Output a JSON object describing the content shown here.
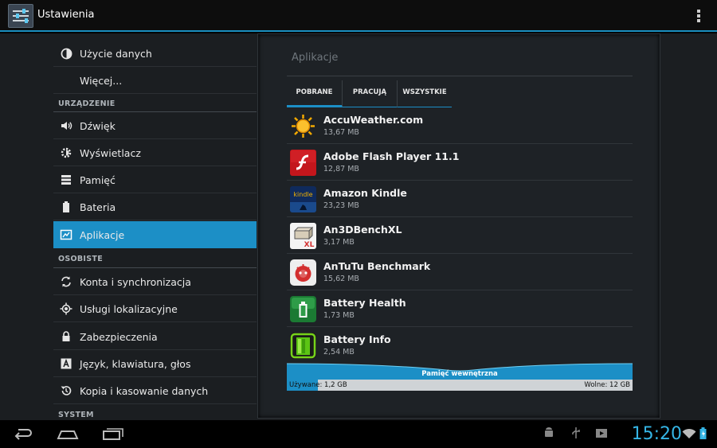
{
  "action_bar": {
    "title": "Ustawienia"
  },
  "sidebar": {
    "items": [
      {
        "label": "Użycie danych",
        "icon": "data-usage-icon"
      },
      {
        "label": "Więcej...",
        "icon": ""
      }
    ],
    "sections": [
      {
        "header": "URZĄDZENIE",
        "items": [
          {
            "label": "Dźwięk",
            "icon": "sound-icon"
          },
          {
            "label": "Wyświetlacz",
            "icon": "display-icon"
          },
          {
            "label": "Pamięć",
            "icon": "storage-icon"
          },
          {
            "label": "Bateria",
            "icon": "battery-icon"
          },
          {
            "label": "Aplikacje",
            "icon": "apps-icon",
            "active": true
          }
        ]
      },
      {
        "header": "OSOBISTE",
        "items": [
          {
            "label": "Konta i synchronizacja",
            "icon": "sync-icon"
          },
          {
            "label": "Usługi lokalizacyjne",
            "icon": "location-icon"
          },
          {
            "label": "Zabezpieczenia",
            "icon": "lock-icon"
          },
          {
            "label": "Język, klawiatura, głos",
            "icon": "language-icon"
          },
          {
            "label": "Kopia i kasowanie danych",
            "icon": "backup-icon"
          }
        ]
      },
      {
        "header": "SYSTEM",
        "items": []
      }
    ]
  },
  "panel": {
    "title": "Aplikacje",
    "tabs": [
      {
        "label": "POBRANE",
        "selected": true
      },
      {
        "label": "PRACUJĄ",
        "selected": false
      },
      {
        "label": "WSZYSTKIE",
        "selected": false
      }
    ],
    "apps": [
      {
        "name": "AccuWeather.com",
        "size": "13,67 MB",
        "icon": "accuweather-sun-icon"
      },
      {
        "name": "Adobe Flash Player 11.1",
        "size": "12,87 MB",
        "icon": "flash-player-icon"
      },
      {
        "name": "Amazon Kindle",
        "size": "23,23 MB",
        "icon": "kindle-icon"
      },
      {
        "name": "An3DBenchXL",
        "size": "3,17 MB",
        "icon": "an3dbench-icon"
      },
      {
        "name": "AnTuTu Benchmark",
        "size": "15,62 MB",
        "icon": "antutu-icon"
      },
      {
        "name": "Battery Health",
        "size": "1,73 MB",
        "icon": "battery-health-icon"
      },
      {
        "name": "Battery Info",
        "size": "2,54 MB",
        "icon": "battery-info-icon"
      }
    ],
    "storage": {
      "label": "Pamięć wewnętrzna",
      "used_label": "Używane: 1,2 GB",
      "free_label": "Wolne: 12 GB",
      "used_fraction": 0.09
    }
  },
  "status_bar": {
    "time": "15:20"
  },
  "colors": {
    "accent": "#1c8fc6",
    "clock": "#35b5e5"
  }
}
